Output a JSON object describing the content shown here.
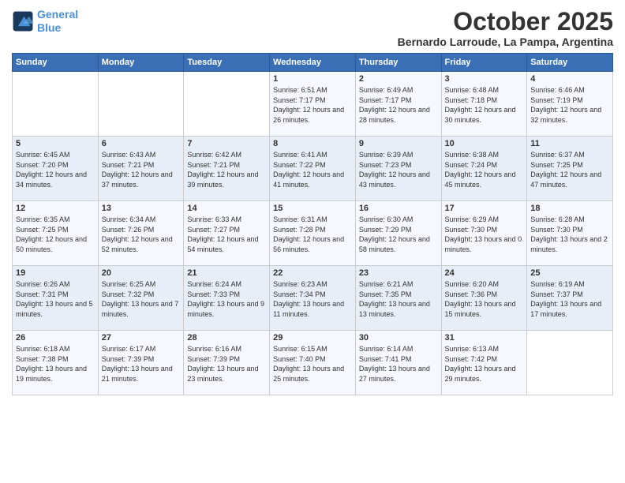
{
  "logo": {
    "line1": "General",
    "line2": "Blue"
  },
  "title": "October 2025",
  "location": "Bernardo Larroude, La Pampa, Argentina",
  "days_of_week": [
    "Sunday",
    "Monday",
    "Tuesday",
    "Wednesday",
    "Thursday",
    "Friday",
    "Saturday"
  ],
  "weeks": [
    [
      null,
      null,
      null,
      {
        "day": 1,
        "sunrise": "6:51 AM",
        "sunset": "7:17 PM",
        "daylight": "12 hours and 26 minutes."
      },
      {
        "day": 2,
        "sunrise": "6:49 AM",
        "sunset": "7:17 PM",
        "daylight": "12 hours and 28 minutes."
      },
      {
        "day": 3,
        "sunrise": "6:48 AM",
        "sunset": "7:18 PM",
        "daylight": "12 hours and 30 minutes."
      },
      {
        "day": 4,
        "sunrise": "6:46 AM",
        "sunset": "7:19 PM",
        "daylight": "12 hours and 32 minutes."
      }
    ],
    [
      {
        "day": 5,
        "sunrise": "6:45 AM",
        "sunset": "7:20 PM",
        "daylight": "12 hours and 34 minutes."
      },
      {
        "day": 6,
        "sunrise": "6:43 AM",
        "sunset": "7:21 PM",
        "daylight": "12 hours and 37 minutes."
      },
      {
        "day": 7,
        "sunrise": "6:42 AM",
        "sunset": "7:21 PM",
        "daylight": "12 hours and 39 minutes."
      },
      {
        "day": 8,
        "sunrise": "6:41 AM",
        "sunset": "7:22 PM",
        "daylight": "12 hours and 41 minutes."
      },
      {
        "day": 9,
        "sunrise": "6:39 AM",
        "sunset": "7:23 PM",
        "daylight": "12 hours and 43 minutes."
      },
      {
        "day": 10,
        "sunrise": "6:38 AM",
        "sunset": "7:24 PM",
        "daylight": "12 hours and 45 minutes."
      },
      {
        "day": 11,
        "sunrise": "6:37 AM",
        "sunset": "7:25 PM",
        "daylight": "12 hours and 47 minutes."
      }
    ],
    [
      {
        "day": 12,
        "sunrise": "6:35 AM",
        "sunset": "7:25 PM",
        "daylight": "12 hours and 50 minutes."
      },
      {
        "day": 13,
        "sunrise": "6:34 AM",
        "sunset": "7:26 PM",
        "daylight": "12 hours and 52 minutes."
      },
      {
        "day": 14,
        "sunrise": "6:33 AM",
        "sunset": "7:27 PM",
        "daylight": "12 hours and 54 minutes."
      },
      {
        "day": 15,
        "sunrise": "6:31 AM",
        "sunset": "7:28 PM",
        "daylight": "12 hours and 56 minutes."
      },
      {
        "day": 16,
        "sunrise": "6:30 AM",
        "sunset": "7:29 PM",
        "daylight": "12 hours and 58 minutes."
      },
      {
        "day": 17,
        "sunrise": "6:29 AM",
        "sunset": "7:30 PM",
        "daylight": "13 hours and 0 minutes."
      },
      {
        "day": 18,
        "sunrise": "6:28 AM",
        "sunset": "7:30 PM",
        "daylight": "13 hours and 2 minutes."
      }
    ],
    [
      {
        "day": 19,
        "sunrise": "6:26 AM",
        "sunset": "7:31 PM",
        "daylight": "13 hours and 5 minutes."
      },
      {
        "day": 20,
        "sunrise": "6:25 AM",
        "sunset": "7:32 PM",
        "daylight": "13 hours and 7 minutes."
      },
      {
        "day": 21,
        "sunrise": "6:24 AM",
        "sunset": "7:33 PM",
        "daylight": "13 hours and 9 minutes."
      },
      {
        "day": 22,
        "sunrise": "6:23 AM",
        "sunset": "7:34 PM",
        "daylight": "13 hours and 11 minutes."
      },
      {
        "day": 23,
        "sunrise": "6:21 AM",
        "sunset": "7:35 PM",
        "daylight": "13 hours and 13 minutes."
      },
      {
        "day": 24,
        "sunrise": "6:20 AM",
        "sunset": "7:36 PM",
        "daylight": "13 hours and 15 minutes."
      },
      {
        "day": 25,
        "sunrise": "6:19 AM",
        "sunset": "7:37 PM",
        "daylight": "13 hours and 17 minutes."
      }
    ],
    [
      {
        "day": 26,
        "sunrise": "6:18 AM",
        "sunset": "7:38 PM",
        "daylight": "13 hours and 19 minutes."
      },
      {
        "day": 27,
        "sunrise": "6:17 AM",
        "sunset": "7:39 PM",
        "daylight": "13 hours and 21 minutes."
      },
      {
        "day": 28,
        "sunrise": "6:16 AM",
        "sunset": "7:39 PM",
        "daylight": "13 hours and 23 minutes."
      },
      {
        "day": 29,
        "sunrise": "6:15 AM",
        "sunset": "7:40 PM",
        "daylight": "13 hours and 25 minutes."
      },
      {
        "day": 30,
        "sunrise": "6:14 AM",
        "sunset": "7:41 PM",
        "daylight": "13 hours and 27 minutes."
      },
      {
        "day": 31,
        "sunrise": "6:13 AM",
        "sunset": "7:42 PM",
        "daylight": "13 hours and 29 minutes."
      },
      null
    ]
  ]
}
